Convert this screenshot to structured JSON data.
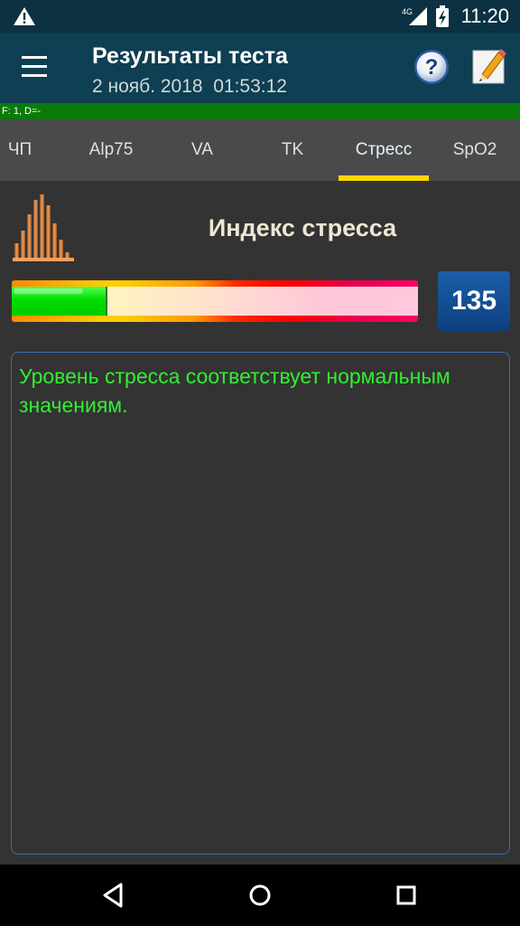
{
  "status_bar": {
    "network": "4G",
    "time": "11:20"
  },
  "header": {
    "title": "Результаты теста",
    "subtitle": "2 нояб. 2018  01:53:12",
    "help_icon": "help-circle-icon",
    "notes_icon": "edit-note-icon"
  },
  "info_line": "F: 1, D=-",
  "tabs": [
    {
      "label": "ЧП",
      "active": false
    },
    {
      "label": "Alp75",
      "active": false
    },
    {
      "label": "VA",
      "active": false
    },
    {
      "label": "TK",
      "active": false
    },
    {
      "label": "Стресс",
      "active": true
    },
    {
      "label": "SpO2",
      "active": false
    }
  ],
  "stress": {
    "title": "Индекс стресса",
    "value": "135",
    "gauge_fraction": 0.23,
    "result_text": "Уровень стресса соответствует нормальным значениям."
  },
  "colors": {
    "app_bar": "#0e3f52",
    "info_line": "#0a7a0a",
    "tab_indicator": "#ffd600",
    "result_text": "#33ee33",
    "value_badge": "#1b5fa8"
  }
}
